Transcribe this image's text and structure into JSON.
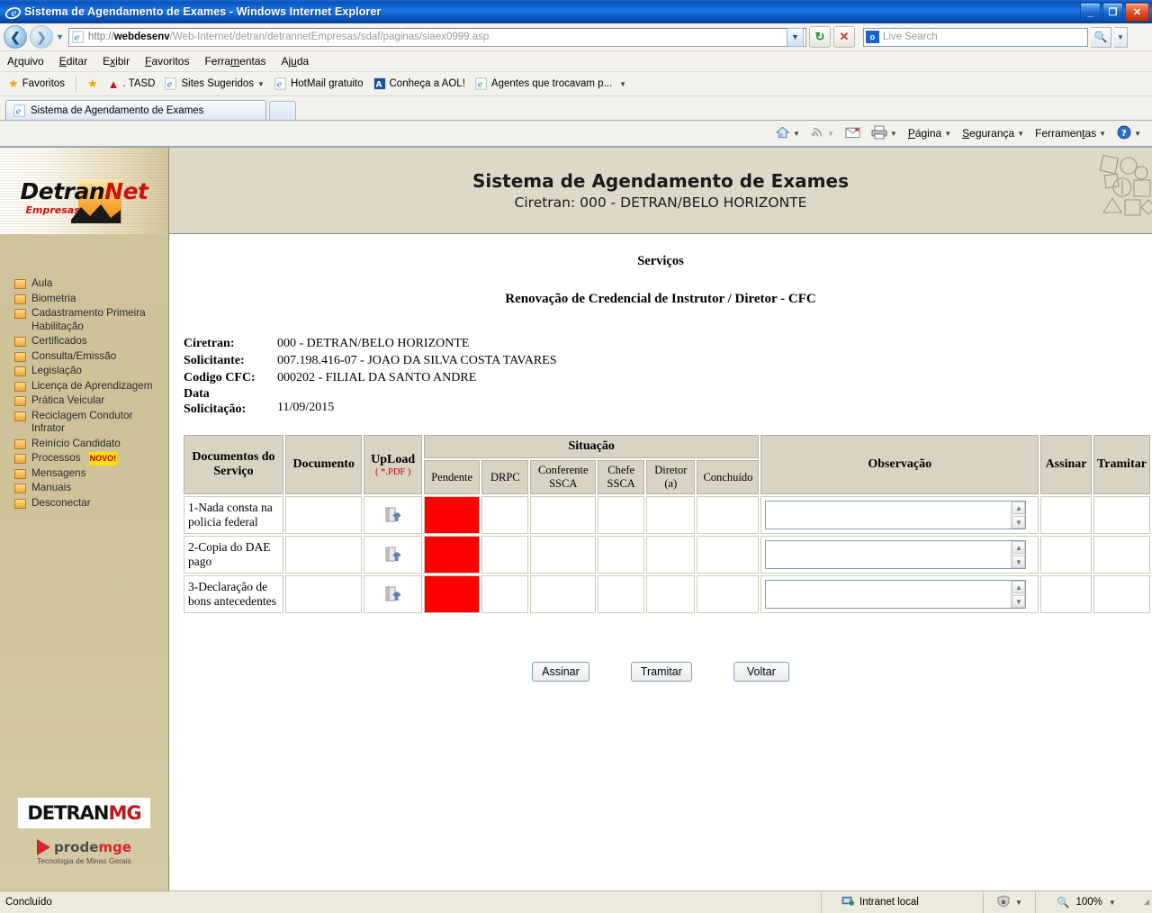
{
  "window": {
    "title": "Sistema de Agendamento de Exames - Windows Internet Explorer",
    "minimize": "_",
    "restore": "❐",
    "close": "✕"
  },
  "address_bar": {
    "back_icon": "back-arrow-icon",
    "forward_icon": "forward-arrow-icon",
    "url_protocol": "http://",
    "url_host": "webdesenv",
    "url_path": "/Web-Internet/detran/detrannetEmpresas/sdaf/paginas/siaex0999.asp",
    "refresh_label": "↻",
    "stop_label": "✕",
    "search_placeholder": "Live Search",
    "search_value": ""
  },
  "menu": {
    "items": [
      {
        "label": "Arquivo",
        "accel": "A"
      },
      {
        "label": "Editar",
        "accel": "E"
      },
      {
        "label": "Exibir",
        "accel": "x"
      },
      {
        "label": "Favoritos",
        "accel": "F"
      },
      {
        "label": "Ferramentas",
        "accel": "m"
      },
      {
        "label": "Ajuda",
        "accel": "u"
      }
    ]
  },
  "favorites_bar": {
    "favorites_label": "Favoritos",
    "items": [
      {
        "label": ". TASD",
        "icon": "red-a-icon"
      },
      {
        "label": "Sites Sugeridos",
        "icon": "ie-icon",
        "has_caret": true
      },
      {
        "label": "HotMail gratuito",
        "icon": "ie-icon"
      },
      {
        "label": "Conheça a AOL!",
        "icon": "aol-icon"
      },
      {
        "label": "Agentes que trocavam p...",
        "icon": "ie-icon"
      }
    ],
    "overflow": "▼"
  },
  "tabs": [
    {
      "label": "Sistema de Agendamento de Exames",
      "active": true
    }
  ],
  "command_bar": {
    "items": [
      {
        "label": "",
        "icon": "home-icon",
        "caret": true
      },
      {
        "label": "",
        "icon": "feeds-icon",
        "caret": true
      },
      {
        "label": "",
        "icon": "mail-icon",
        "caret": false
      },
      {
        "label": "",
        "icon": "print-icon",
        "caret": true
      },
      {
        "label": "Página",
        "icon": "",
        "caret": true
      },
      {
        "label": "Segurança",
        "icon": "",
        "caret": true
      },
      {
        "label": "Ferramentas",
        "icon": "",
        "caret": true
      },
      {
        "label": "",
        "icon": "help-icon",
        "caret": true
      }
    ]
  },
  "sidebar": {
    "logo": {
      "brand_main": "Detran",
      "brand_accent": "Net",
      "brand_sub": "Empresas"
    },
    "items": [
      {
        "label": "Aula"
      },
      {
        "label": "Biometria"
      },
      {
        "label": "Cadastramento Primeira Habilitação"
      },
      {
        "label": "Certificados"
      },
      {
        "label": "Consulta/Emissão"
      },
      {
        "label": "Legislação"
      },
      {
        "label": "Licença de Aprendizagem"
      },
      {
        "label": "Prática Veicular"
      },
      {
        "label": "Reciclagem Condutor Infrator"
      },
      {
        "label": "Reinício Candidato"
      },
      {
        "label": "Processos",
        "badge": "NOVO!"
      },
      {
        "label": "Mensagens"
      },
      {
        "label": "Manuais"
      },
      {
        "label": "Desconectar"
      }
    ],
    "footer_logos": {
      "detran": "DETRAN",
      "detran_accent": "MG",
      "prodemge": "prode",
      "prodemge_accent": "mge",
      "prodemge_tagline": "Tecnologia de Minas Gerais"
    }
  },
  "banner": {
    "title": "Sistema de Agendamento de Exames",
    "subtitle": "Ciretran: 000 - DETRAN/BELO HORIZONTE"
  },
  "main": {
    "section_title": "Serviços",
    "page_title": "Renovação de Credencial de Instrutor / Diretor - CFC",
    "info": [
      {
        "label": "Ciretran:",
        "value": "000 - DETRAN/BELO HORIZONTE"
      },
      {
        "label": "Solicitante:",
        "value": "007.198.416-07 - JOAO DA SILVA COSTA TAVARES"
      },
      {
        "label": "Codigo CFC:",
        "value": "000202 - FILIAL DA SANTO ANDRE"
      },
      {
        "label": "Data Solicitação:",
        "value": "11/09/2015"
      }
    ],
    "table": {
      "headers": {
        "documentos": "Documentos do Serviço",
        "documento": "Documento",
        "upload": "UpLoad",
        "upload_note": "( *.PDF )",
        "situacao": "Situação",
        "pendente": "Pendente",
        "drpc": "DRPC",
        "conferente_ssca": "Conferente SSCA",
        "chefe_ssca": "Chefe SSCA",
        "diretor": "Diretor (a)",
        "concluido": "Conchuído",
        "observacao": "Observação",
        "assinar": "Assinar",
        "tramitar": "Tramitar"
      },
      "rows": [
        {
          "documento_servico": "1-Nada consta na policia federal",
          "documento": "",
          "upload_icon": "upload-file-icon",
          "pendente": "",
          "pendente_flag": true,
          "drpc": "",
          "conferente_ssca": "",
          "chefe_ssca": "",
          "diretor": "",
          "concluido": "",
          "observacao": "",
          "assinar": "",
          "tramitar": ""
        },
        {
          "documento_servico": "2-Copia do DAE pago",
          "documento": "",
          "upload_icon": "upload-file-icon",
          "pendente": "",
          "pendente_flag": true,
          "drpc": "",
          "conferente_ssca": "",
          "chefe_ssca": "",
          "diretor": "",
          "concluido": "",
          "observacao": "",
          "assinar": "",
          "tramitar": ""
        },
        {
          "documento_servico": "3-Declaração de bons antecedentes",
          "documento": "",
          "upload_icon": "upload-file-icon",
          "pendente": "",
          "pendente_flag": true,
          "drpc": "",
          "conferente_ssca": "",
          "chefe_ssca": "",
          "diretor": "",
          "concluido": "",
          "observacao": "",
          "assinar": "",
          "tramitar": ""
        }
      ],
      "pendente_color": "#ff0000",
      "header_bg": "#d9d3c4"
    },
    "buttons": [
      {
        "label": "Assinar"
      },
      {
        "label": "Tramitar"
      },
      {
        "label": "Voltar"
      }
    ]
  },
  "status_bar": {
    "message": "Concluído",
    "zone_icon": "network-zone-icon",
    "zone": "Intranet local",
    "protected_icon": "protected-mode-icon",
    "zoom_icon": "zoom-icon",
    "zoom": "100%"
  }
}
